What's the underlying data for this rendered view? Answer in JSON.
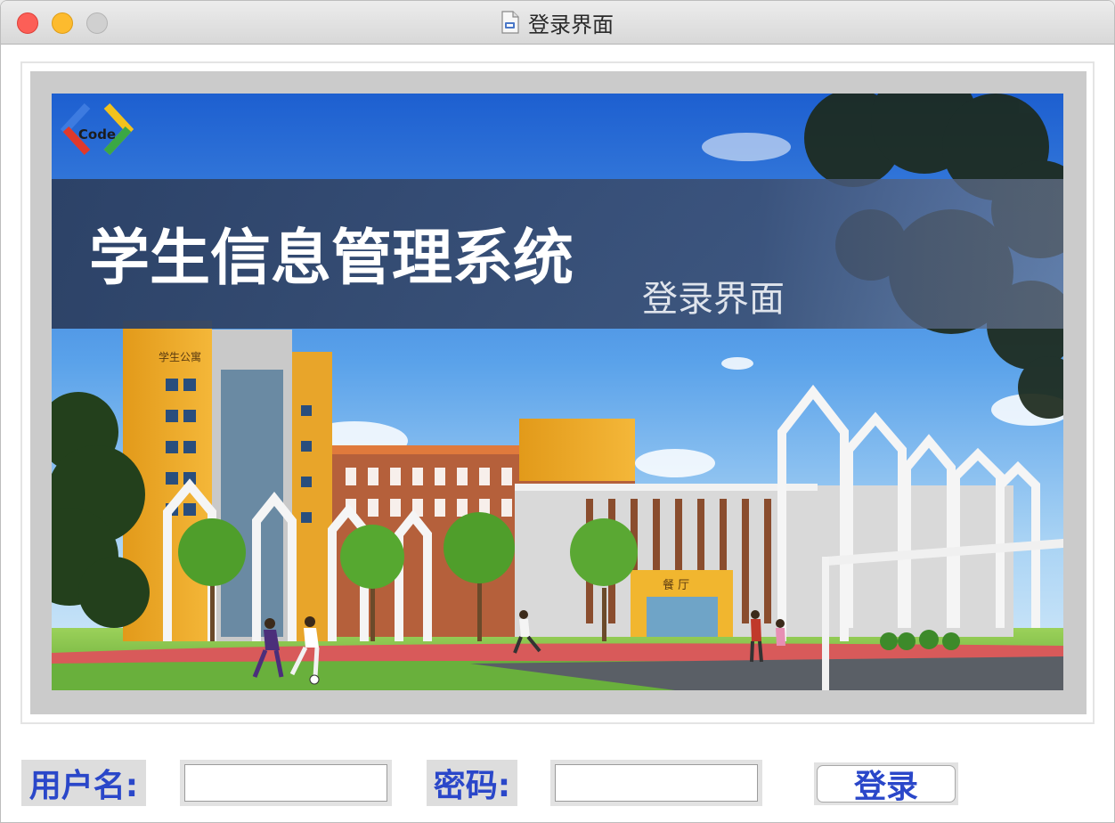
{
  "window": {
    "title": "登录界面"
  },
  "banner": {
    "logo_text": "Code",
    "system_title": "学生信息管理系统",
    "subtitle": "登录界面",
    "building_sign": "学生公寓",
    "hall_sign": "餐 厅"
  },
  "form": {
    "username_label": "用户名:",
    "username_value": "",
    "password_label": "密码:",
    "password_value": "",
    "login_label": "登录"
  },
  "colors": {
    "label_blue": "#2a47c9",
    "close": "#fc5f57",
    "minimize": "#fdbb2e",
    "zoom_disabled": "#d0d0d0"
  }
}
